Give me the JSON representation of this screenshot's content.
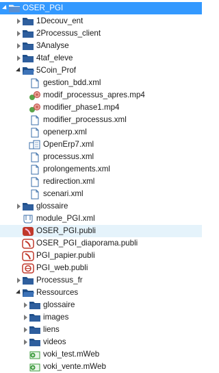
{
  "tree": {
    "root": "OSER_PGI",
    "items": [
      {
        "label": "1Decouv_ent",
        "icon": "folder-icon",
        "toggle": "collapsed"
      },
      {
        "label": "2Processus_client",
        "icon": "folder-icon",
        "toggle": "collapsed"
      },
      {
        "label": "3Analyse",
        "icon": "folder-icon",
        "toggle": "collapsed"
      },
      {
        "label": "4taf_eleve",
        "icon": "folder-icon",
        "toggle": "collapsed"
      },
      {
        "label": "5Coin_Prof",
        "icon": "folder-open-icon",
        "toggle": "expanded"
      },
      {
        "label": "gestion_bdd.xml",
        "icon": "file-icon"
      },
      {
        "label": "modif_processus_apres.mp4",
        "icon": "media-file-icon"
      },
      {
        "label": "modifier_phase1.mp4",
        "icon": "media-file-icon"
      },
      {
        "label": "modifier_processus.xml",
        "icon": "file-icon"
      },
      {
        "label": "openerp.xml",
        "icon": "file-icon"
      },
      {
        "label": "OpenErp7.xml",
        "icon": "linked-file-icon"
      },
      {
        "label": "processus.xml",
        "icon": "file-icon"
      },
      {
        "label": "prolongements.xml",
        "icon": "file-icon"
      },
      {
        "label": "redirection.xml",
        "icon": "file-icon"
      },
      {
        "label": "scenari.xml",
        "icon": "file-icon"
      },
      {
        "label": "glossaire",
        "icon": "folder-icon",
        "toggle": "collapsed"
      },
      {
        "label": "module_PGI.xml",
        "icon": "module-file-icon"
      },
      {
        "label": "OSER_PGI.publi",
        "icon": "publication-icon"
      },
      {
        "label": "OSER_PGI_diaporama.publi",
        "icon": "publication-outline-icon"
      },
      {
        "label": "PGI_papier.publi",
        "icon": "publication-outline-icon"
      },
      {
        "label": "PGI_web.publi",
        "icon": "publication-web-icon"
      },
      {
        "label": "Processus_fr",
        "icon": "folder-icon",
        "toggle": "collapsed"
      },
      {
        "label": "Ressources",
        "icon": "folder-open-icon",
        "toggle": "expanded"
      },
      {
        "label": "glossaire",
        "icon": "folder-icon",
        "toggle": "collapsed"
      },
      {
        "label": "images",
        "icon": "folder-icon",
        "toggle": "collapsed"
      },
      {
        "label": "liens",
        "icon": "folder-icon",
        "toggle": "collapsed"
      },
      {
        "label": "videos",
        "icon": "folder-icon",
        "toggle": "collapsed"
      },
      {
        "label": "voki_test.mWeb",
        "icon": "web-link-icon"
      },
      {
        "label": "voki_vente.mWeb",
        "icon": "web-link-icon"
      }
    ]
  },
  "colors": {
    "root_selection": "#3399ff",
    "item_selection": "#cce8ff",
    "folder": "#2f5f9e",
    "publication": "#c0392b",
    "web_link": "#3a9a3a"
  }
}
